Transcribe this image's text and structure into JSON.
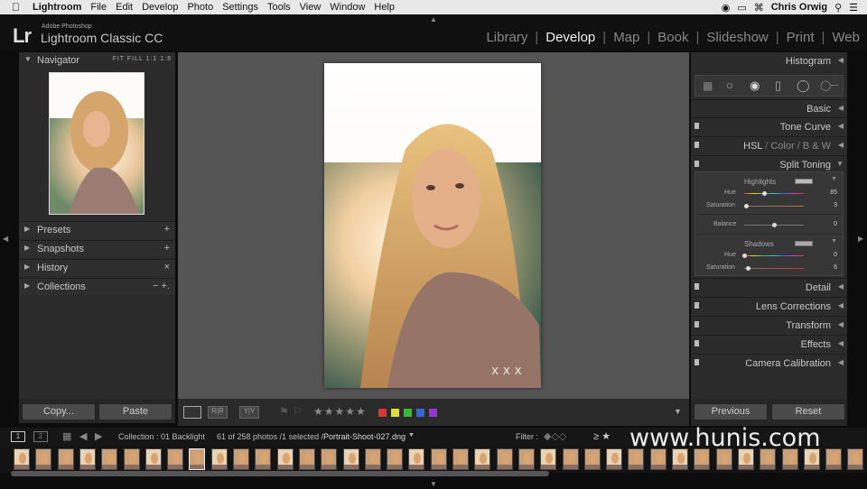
{
  "menubar": {
    "apple": "",
    "app": "Lightroom",
    "items": [
      "File",
      "Edit",
      "Develop",
      "Photo",
      "Settings",
      "Tools",
      "View",
      "Window",
      "Help"
    ],
    "user": "Chris Orwig"
  },
  "brand": {
    "logo": "Lr",
    "small": "Adobe Photoshop",
    "big": "Lightroom Classic CC"
  },
  "modules": [
    "Library",
    "Develop",
    "Map",
    "Book",
    "Slideshow",
    "Print",
    "Web"
  ],
  "active_module": "Develop",
  "left": {
    "navigator": "Navigator",
    "nav_opts": "FIT  FILL  1:1  1:8",
    "panels": [
      {
        "label": "Presets",
        "action": "+"
      },
      {
        "label": "Snapshots",
        "action": "+"
      },
      {
        "label": "History",
        "action": "×"
      },
      {
        "label": "Collections",
        "action": "−  +."
      }
    ],
    "copy": "Copy...",
    "paste": "Paste"
  },
  "right": {
    "histogram": "Histogram",
    "panels": [
      "Basic",
      "Tone Curve"
    ],
    "hsl": {
      "a": "HSL",
      "b": "Color",
      "c": "B & W"
    },
    "split": "Split Toning",
    "highlights": "Highlights",
    "shadows": "Shadows",
    "balance": "Balance",
    "hue": "Hue",
    "saturation": "Saturation",
    "hl_hue": "85",
    "hl_sat": "3",
    "bal": "0",
    "sh_hue": "0",
    "sh_sat": "6",
    "hl_hue_level": 0.33,
    "hl_sat_level": 0.03,
    "bal_level": 0.5,
    "sh_hue_level": 0.0,
    "sh_sat_level": 0.06,
    "lower": [
      "Detail",
      "Lens Corrections",
      "Transform",
      "Effects",
      "Camera Calibration"
    ],
    "previous": "Previous",
    "reset": "Reset"
  },
  "filmstrip": {
    "collection": "Collection : 01 Backlight",
    "count": "61 of 258 photos /1 selected /",
    "file": "Portrait-Shoot-027.dng",
    "filter": "Filter :",
    "page1": "1",
    "page2": "2"
  },
  "watermark": "www.hunis.com",
  "colors": {
    "accent": "#e8e8e8",
    "bg": "#0c0c0c",
    "panel": "#2b2b2b",
    "label_red": "#d33",
    "label_yellow": "#dd3",
    "label_green": "#3b3",
    "label_blue": "#36d",
    "label_purple": "#93d"
  }
}
